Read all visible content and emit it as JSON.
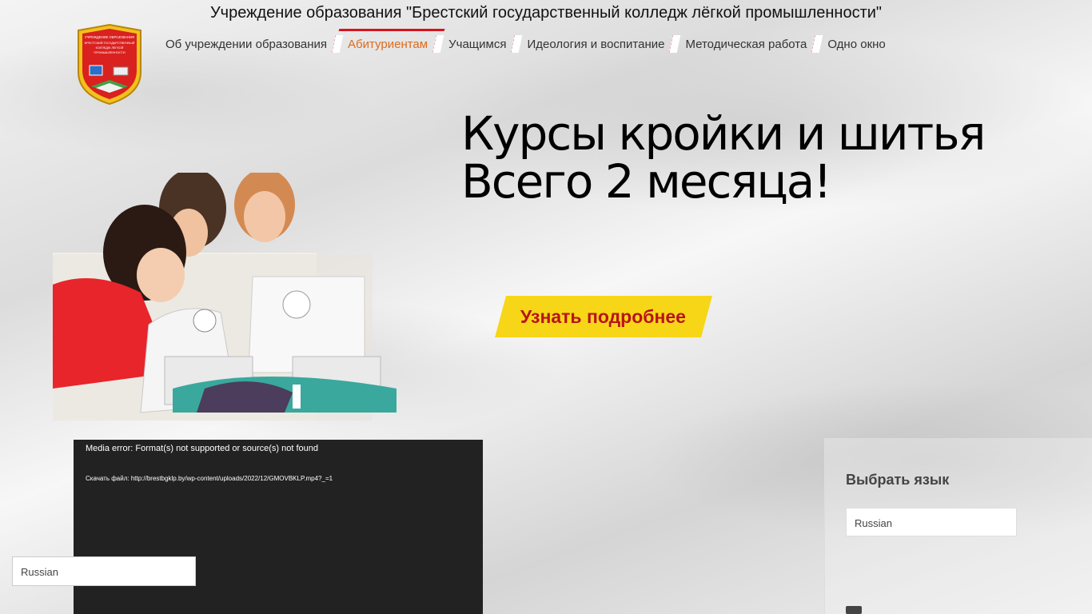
{
  "site": {
    "title": "Учреждение образования \"Брестский государственный колледж лёгкой промышленности\"",
    "logo_text": [
      "УЧРЕЖДЕНИЕ ОБРАЗОВАНИЯ",
      "БРЕСТСКИЙ ГОСУДАРСТВЕННЫЙ",
      "КОЛЛЕДЖ ЛЕГКОЙ",
      "ПРОМЫШЛЕННОСТИ"
    ]
  },
  "nav": {
    "items": [
      {
        "label": "Об учреждении образования",
        "active": false
      },
      {
        "label": "Абитуриентам",
        "active": true
      },
      {
        "label": "Учащимся",
        "active": false
      },
      {
        "label": "Идеология и воспитание",
        "active": false
      },
      {
        "label": "Методическая работа",
        "active": false
      },
      {
        "label": "Одно окно",
        "active": false
      }
    ],
    "active_color": "#e06a1b",
    "indicator_color": "#d6141c"
  },
  "hero": {
    "headline_line1": "Курсы кройки и шитья",
    "headline_line2": "Всего 2 месяца!",
    "cta_label": "Узнать подробнее",
    "cta_bg": "#f7d617",
    "cta_color": "#b8141b"
  },
  "video": {
    "error": "Media error: Format(s) not supported or source(s) not found",
    "download": "Скачать файл: http://brestbgklp.by/wp-content/uploads/2022/12/GMOVBKLP.mp4?_=1"
  },
  "sidebar": {
    "language_title": "Выбрать язык",
    "language_value": "Russian"
  },
  "floating_language": {
    "value": "Russian"
  }
}
